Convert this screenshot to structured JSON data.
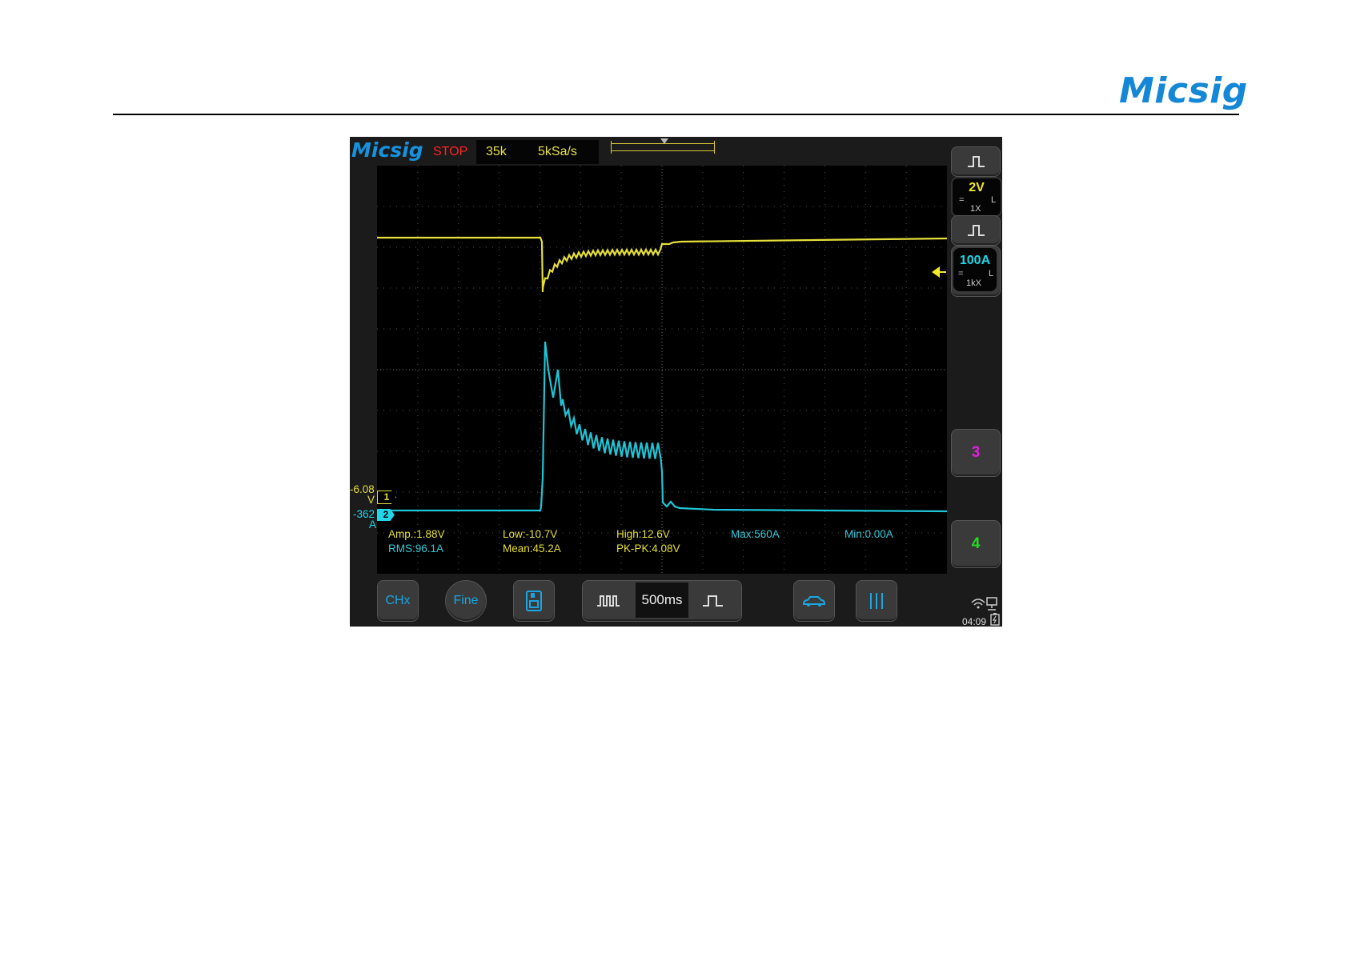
{
  "header": {
    "brand": "Micsig"
  },
  "scope": {
    "logo": "Micsig",
    "run_state": "STOP",
    "memory_depth": "35k",
    "sample_rate": "5kSa/s",
    "timebase": "500ms",
    "time": "04:09",
    "channels": {
      "ch1": {
        "number": "1",
        "scale": "2V",
        "coupling": "=",
        "bandwidth": "L",
        "probe": "1X",
        "offset_value": "-6.08",
        "offset_unit": "V",
        "color": "#e6df3a"
      },
      "ch2": {
        "number": "2",
        "scale": "100A",
        "coupling": "=",
        "bandwidth": "L",
        "probe": "1kX",
        "offset_value": "-362",
        "offset_unit": "A",
        "color": "#20d6e8"
      },
      "ch3": {
        "label": "3",
        "color": "#e020e0"
      },
      "ch4": {
        "label": "4",
        "color": "#22dd22"
      }
    },
    "trigger_marker": "T",
    "measurements": {
      "amp": "Amp.:1.88V",
      "rms": "RMS:96.1A",
      "low": "Low:-10.7V",
      "mean": "Mean:45.2A",
      "high": "High:12.6V",
      "pkpk": "PK-PK:4.08V",
      "max": "Max:560A",
      "min": "Min:0.00A"
    },
    "bottom_bar": {
      "chx": "CHx",
      "fine": "Fine",
      "save_icon": "save-icon",
      "timebase_decrease_icon": "pulse-train-icon",
      "timebase_increase_icon": "single-pulse-icon",
      "auto_icon": "car-icon",
      "cursor_icon": "cursor-lines-icon"
    }
  }
}
